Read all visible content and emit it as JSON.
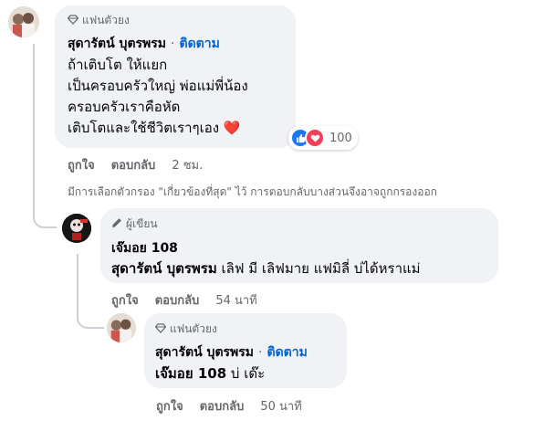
{
  "comment1": {
    "badge": "แฟนตัวยง",
    "author": "สุดารัตน์ บุตรพรม",
    "follow": "ติดตาม",
    "lines": [
      "ถ้าเติบโต ให้แยก",
      "เป็นครอบครัวใหญ่ พ่อแม่พี่น้อง",
      "ครอบครัวเราคือหัด",
      "เติบโตและใช้ชีวิตเราๆเอง"
    ],
    "heart_emoji": "❤️",
    "reaction_count": "100",
    "like": "ถูกใจ",
    "reply": "ตอบกลับ",
    "time": "2 ชม."
  },
  "filter_note": "มีการเลือกตัวกรอง \"เกี่ยวข้องที่สุด\" ไว้ การตอบกลับบางส่วนจึงอาจถูกกรองออก",
  "comment2": {
    "badge": "ผู้เขียน",
    "author": "เจ๊มอย 108",
    "mention": "สุดารัตน์ บุตรพรม",
    "text": " เลิฟ มี เลิฟมาย แฟมิลี่ บ่ได้หราแม่",
    "like": "ถูกใจ",
    "reply": "ตอบกลับ",
    "time": "54 นาที"
  },
  "comment3": {
    "badge": "แฟนตัวยง",
    "author": "สุดารัตน์ บุตรพรม",
    "follow": "ติดตาม",
    "mention": "เจ๊มอย 108",
    "text": " บ่ เด๊ะ",
    "like": "ถูกใจ",
    "reply": "ตอบกลับ",
    "time": "50 นาที"
  },
  "colors": {
    "bubble": "#f0f2f5",
    "link": "#0064d1",
    "muted": "#65676b",
    "like_blue": "#1877f2",
    "love_red": "#f33e58"
  },
  "icons": {
    "badge1": "diamond-icon",
    "badge2": "pencil-icon",
    "badge3": "diamond-icon",
    "like": "thumbs-up-icon",
    "love": "heart-icon"
  }
}
